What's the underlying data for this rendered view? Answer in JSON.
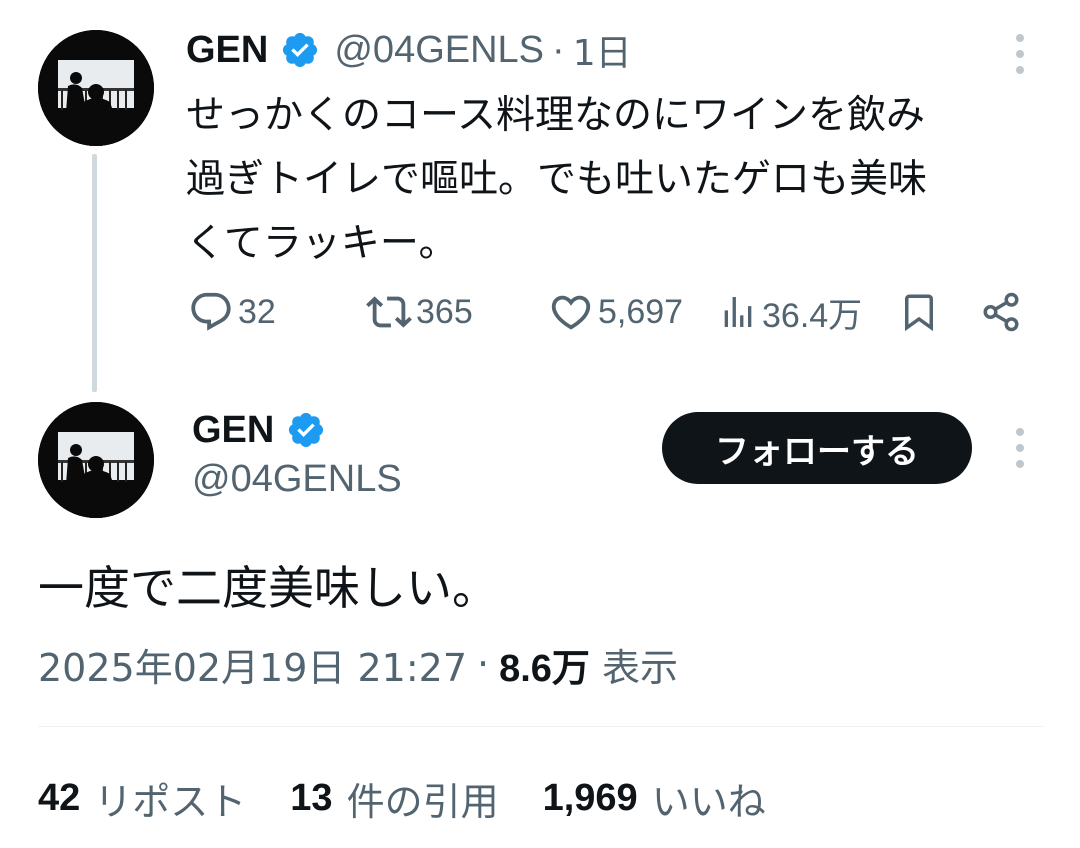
{
  "colors": {
    "text_primary": "#0f1419",
    "text_secondary": "#536471",
    "verified_blue": "#1d9bf0",
    "thread_line": "#cfd9de",
    "follow_button_bg": "#0f1419"
  },
  "tweet1": {
    "author_name": "GEN",
    "verified_icon": "verified-badge-icon",
    "handle": "@04GENLS",
    "separator": "·",
    "time": "1日",
    "text_lines": [
      "せっかくのコース料理なのにワインを飲み",
      "過ぎトイレで嘔吐。でも吐いたゲロも美味",
      "くてラッキー。"
    ],
    "actions": {
      "replies": "32",
      "retweets": "365",
      "likes": "5,697",
      "views": "36.4万"
    }
  },
  "tweet2": {
    "author_name": "GEN",
    "handle": "@04GENLS",
    "follow_label": "フォローする",
    "text": "一度で二度美味しい。",
    "date": "2025年02月19日 21:27",
    "separator": "·",
    "views_count": "8.6万",
    "views_label": "表示",
    "stats": [
      {
        "num": "42",
        "label": "リポスト"
      },
      {
        "num": "13",
        "label": "件の引用"
      },
      {
        "num": "1,969",
        "label": "いいね"
      }
    ]
  }
}
